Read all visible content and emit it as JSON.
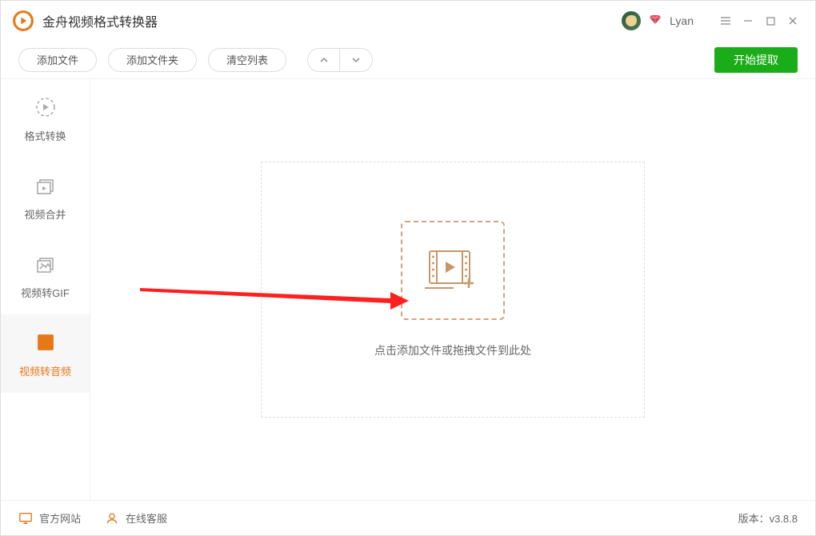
{
  "app": {
    "title": "金舟视频格式转换器"
  },
  "user": {
    "name": "Lyan"
  },
  "toolbar": {
    "add_file": "添加文件",
    "add_folder": "添加文件夹",
    "clear_list": "清空列表",
    "start": "开始提取"
  },
  "sidebar": {
    "format_convert": "格式转换",
    "video_merge": "视频合并",
    "video_to_gif": "视频转GIF",
    "video_to_audio": "视频转音频"
  },
  "dropzone": {
    "hint": "点击添加文件或拖拽文件到此处"
  },
  "status": {
    "official_site": "官方网站",
    "online_service": "在线客服",
    "version_label": "版本：",
    "version_value": "v3.8.8"
  },
  "colors": {
    "accent_orange": "#e67817",
    "accent_green": "#1aad19",
    "gem_red": "#d94050"
  }
}
